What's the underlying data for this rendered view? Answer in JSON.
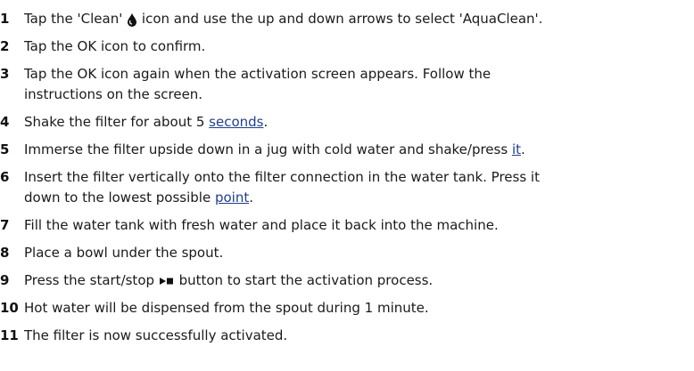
{
  "steps": [
    {
      "num": "1",
      "pre": "Tap the 'Clean' ",
      "icon": "water-drop-icon",
      "post": " icon and use the up and down arrows to select 'AquaClean'."
    },
    {
      "num": "2",
      "text": "Tap the OK icon to confirm."
    },
    {
      "num": "3",
      "line1": "Tap the OK icon again when the activation screen appears. Follow the",
      "line2": "instructions on the screen."
    },
    {
      "num": "4",
      "pre": "Shake the filter for about 5 ",
      "link": "seconds",
      "post": "."
    },
    {
      "num": "5",
      "pre": "Immerse the filter upside down in a jug with cold water and shake/press ",
      "link": "it",
      "post": "."
    },
    {
      "num": "6",
      "line1": "Insert the filter vertically onto the filter connection in the water tank. Press it",
      "pre": "down to the lowest possible ",
      "link": "point",
      "post": "."
    },
    {
      "num": "7",
      "text": "Fill the water tank with fresh water and place it back into the machine."
    },
    {
      "num": "8",
      "text": "Place a bowl under the spout."
    },
    {
      "num": "9",
      "pre": "Press the start/stop ",
      "icon": "start-stop-icon",
      "post": " button to start the activation process."
    },
    {
      "num": "10",
      "text": "Hot water will be dispensed from the spout during 1 minute."
    },
    {
      "num": "11",
      "text": "The filter is now successfully activated."
    }
  ]
}
